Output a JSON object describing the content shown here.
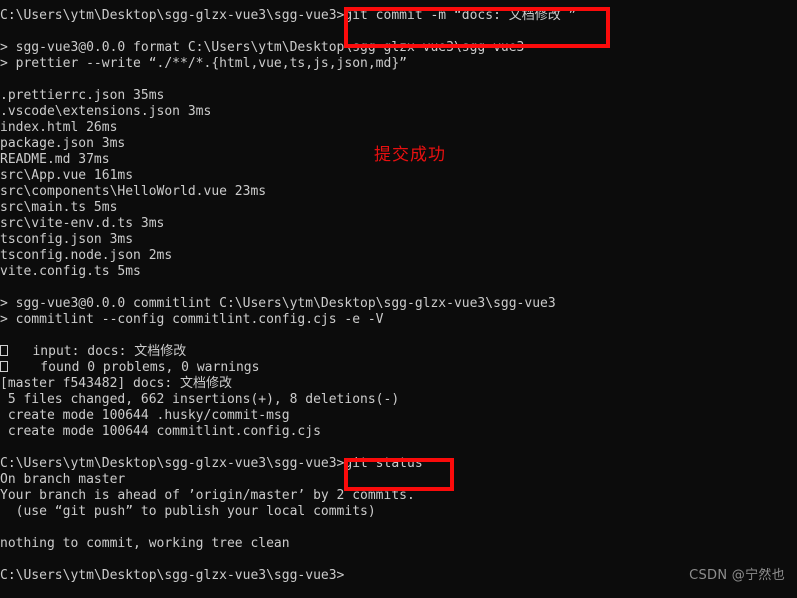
{
  "terminal": {
    "background_color": "#0c0c0c",
    "text_color": "#cccccc",
    "accent_color": "#fb0b0b",
    "watermark": "CSDN @宁然也",
    "lines": [
      {
        "text": "C:\\Users\\ytm\\Desktop\\sgg-glzx-vue3\\sgg-vue3>git commit -m “docs: 文档修改 ”"
      },
      {
        "text": ""
      },
      {
        "text": "> sgg-vue3@0.0.0 format C:\\Users\\ytm\\Desktop\\sgg-glzx-vue3\\sgg-vue3"
      },
      {
        "text": "> prettier --write “./**/*.{html,vue,ts,js,json,md}”"
      },
      {
        "text": ""
      },
      {
        "text": ".prettierrc.json 35ms"
      },
      {
        "text": ".vscode\\extensions.json 3ms"
      },
      {
        "text": "index.html 26ms"
      },
      {
        "text": "package.json 3ms"
      },
      {
        "text": "README.md 37ms"
      },
      {
        "text": "src\\App.vue 161ms"
      },
      {
        "text": "src\\components\\HelloWorld.vue 23ms"
      },
      {
        "text": "src\\main.ts 5ms"
      },
      {
        "text": "src\\vite-env.d.ts 3ms"
      },
      {
        "text": "tsconfig.json 3ms"
      },
      {
        "text": "tsconfig.node.json 2ms"
      },
      {
        "text": "vite.config.ts 5ms"
      },
      {
        "text": ""
      },
      {
        "text": "> sgg-vue3@0.0.0 commitlint C:\\Users\\ytm\\Desktop\\sgg-glzx-vue3\\sgg-vue3"
      },
      {
        "text": "> commitlint --config commitlint.config.cjs -e -V"
      },
      {
        "text": ""
      },
      {
        "text": "   input: docs: 文档修改",
        "tofu": true
      },
      {
        "text": "    found 0 problems, 0 warnings",
        "tofu": true
      },
      {
        "text": "[master f543482] docs: 文档修改"
      },
      {
        "text": " 5 files changed, 662 insertions(+), 8 deletions(-)"
      },
      {
        "text": " create mode 100644 .husky/commit-msg"
      },
      {
        "text": " create mode 100644 commitlint.config.cjs"
      },
      {
        "text": ""
      },
      {
        "text": "C:\\Users\\ytm\\Desktop\\sgg-glzx-vue3\\sgg-vue3>git status"
      },
      {
        "text": "On branch master"
      },
      {
        "text": "Your branch is ahead of ’origin/master’ by 2 commits."
      },
      {
        "text": "  (use “git push” to publish your local commits)"
      },
      {
        "text": ""
      },
      {
        "text": "nothing to commit, working tree clean"
      },
      {
        "text": ""
      },
      {
        "text": "C:\\Users\\ytm\\Desktop\\sgg-glzx-vue3\\sgg-vue3>"
      }
    ]
  },
  "annotations": {
    "commit_command_highlight": "git commit -m “docs: 文档修改 ”",
    "status_command_highlight": "git status",
    "success_note": "提交成功"
  }
}
